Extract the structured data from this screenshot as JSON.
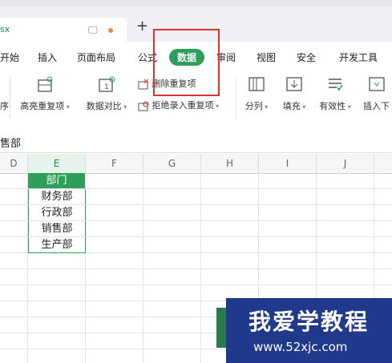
{
  "doc_tab": {
    "filename": "sx"
  },
  "new_tab": "+",
  "ribbon_tabs": [
    "开始",
    "插入",
    "页面布局",
    "公式",
    "数据",
    "审阅",
    "视图",
    "安全",
    "开发工具"
  ],
  "toolbar": {
    "cut_label": "序",
    "highlight_dup": "高亮重复项",
    "data_compare": "数据对比",
    "remove_dup": "删除重复项",
    "reject_dup": "拒绝录入重复项",
    "split": "分列",
    "fill": "填充",
    "validity": "有效性",
    "insert": "插入下"
  },
  "formula_text": "售部",
  "columns": [
    "D",
    "E",
    "F",
    "G",
    "H",
    "I",
    "J"
  ],
  "cells": [
    "部门",
    "财务部",
    "行政部",
    "销售部",
    "生产部"
  ],
  "watermark": {
    "line1": "我爱学教程",
    "line2": "www.52xjc.com"
  },
  "colors": {
    "accent": "#2ca05a",
    "highlight": "#e0312f",
    "header_cell": "#2ca05a"
  }
}
